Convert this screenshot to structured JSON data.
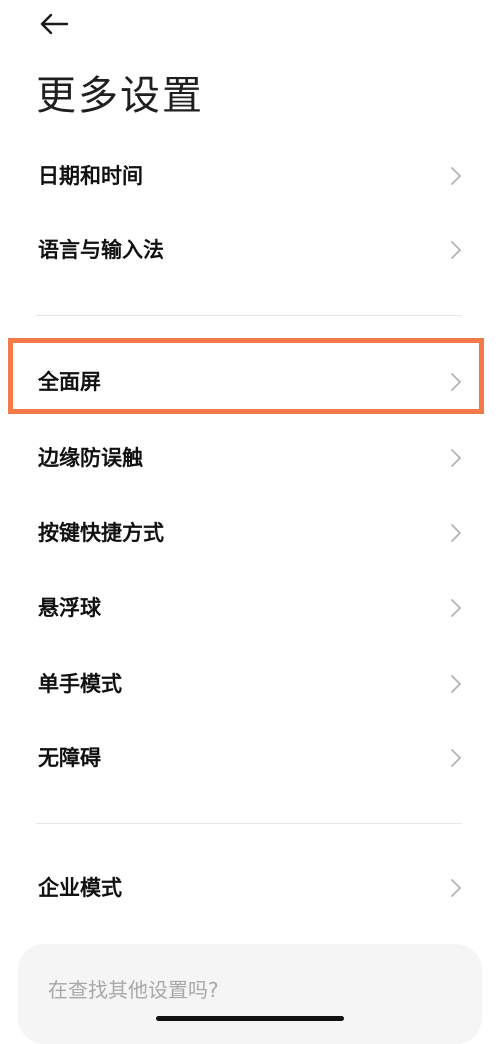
{
  "header": {
    "back_icon": "arrow-left-icon",
    "title": "更多设置"
  },
  "settings": {
    "group1": [
      {
        "label": "日期和时间"
      },
      {
        "label": "语言与输入法"
      }
    ],
    "group2": [
      {
        "label": "全面屏",
        "highlighted": true
      },
      {
        "label": "边缘防误触"
      },
      {
        "label": "按键快捷方式"
      },
      {
        "label": "悬浮球"
      },
      {
        "label": "单手模式"
      },
      {
        "label": "无障碍"
      }
    ],
    "group3": [
      {
        "label": "企业模式"
      }
    ]
  },
  "search_card": {
    "text": "在查找其他设置吗?"
  },
  "colors": {
    "highlight": "#f27a4a",
    "chevron": "#b3b3b3",
    "divider": "#e6e6e6"
  }
}
